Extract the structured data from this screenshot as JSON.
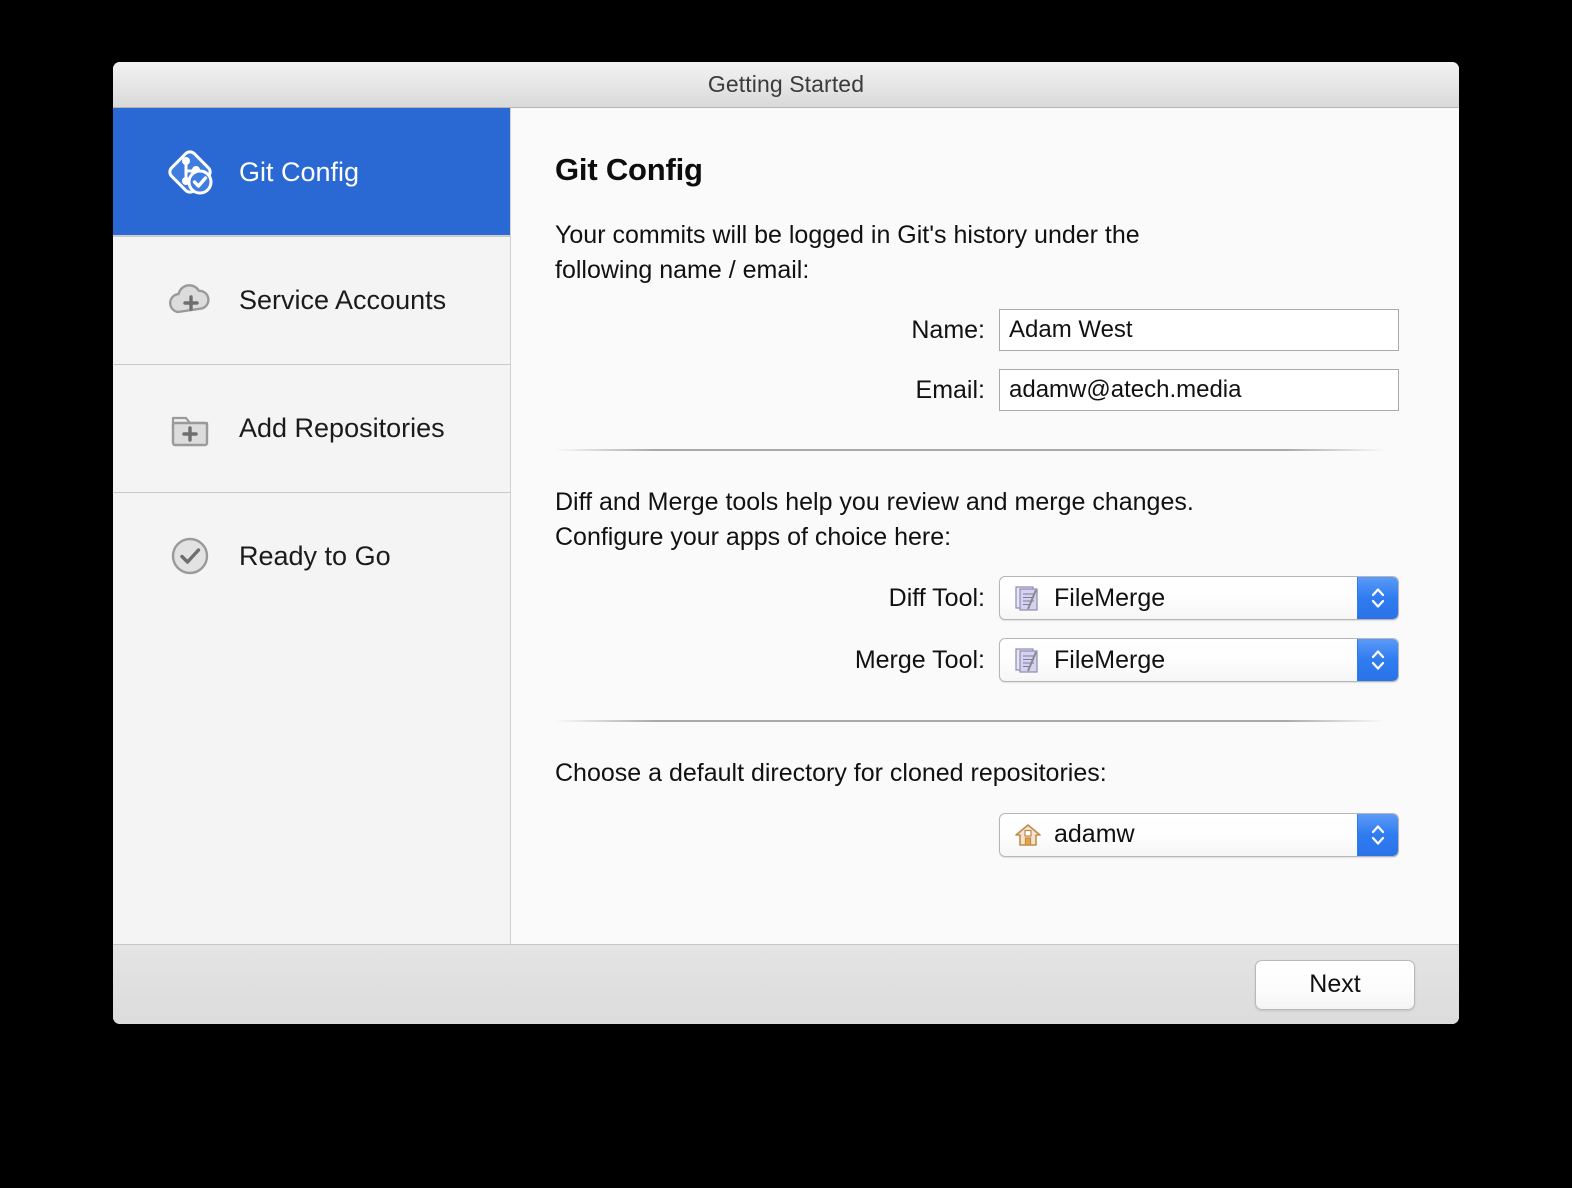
{
  "window": {
    "title": "Getting Started"
  },
  "sidebar": {
    "items": [
      {
        "label": "Git Config",
        "icon": "git-config-icon",
        "selected": true
      },
      {
        "label": "Service Accounts",
        "icon": "cloud-plus-icon",
        "selected": false
      },
      {
        "label": "Add Repositories",
        "icon": "folder-plus-icon",
        "selected": false
      },
      {
        "label": "Ready to Go",
        "icon": "check-circle-icon",
        "selected": false
      }
    ]
  },
  "content": {
    "heading": "Git Config",
    "intro_text": "Your commits will be logged in Git's history under the following name / email:",
    "name_label": "Name:",
    "name_value": "Adam West",
    "email_label": "Email:",
    "email_value": "adamw@atech.media",
    "tools_text": "Diff and Merge tools help you review and merge changes. Configure your apps of choice here:",
    "diff_tool_label": "Diff Tool:",
    "diff_tool_value": "FileMerge",
    "diff_tool_icon": "filemerge-icon",
    "merge_tool_label": "Merge Tool:",
    "merge_tool_value": "FileMerge",
    "merge_tool_icon": "filemerge-icon",
    "directory_text": "Choose a default directory for cloned repositories:",
    "directory_value": "adamw",
    "directory_icon": "home-folder-icon"
  },
  "footer": {
    "next_label": "Next"
  },
  "colors": {
    "selection_blue": "#2a69d3",
    "stepper_blue": "#2f7cf0",
    "window_background": "#fafafa",
    "sidebar_background": "#f4f4f4",
    "desktop_background": "#000000"
  }
}
